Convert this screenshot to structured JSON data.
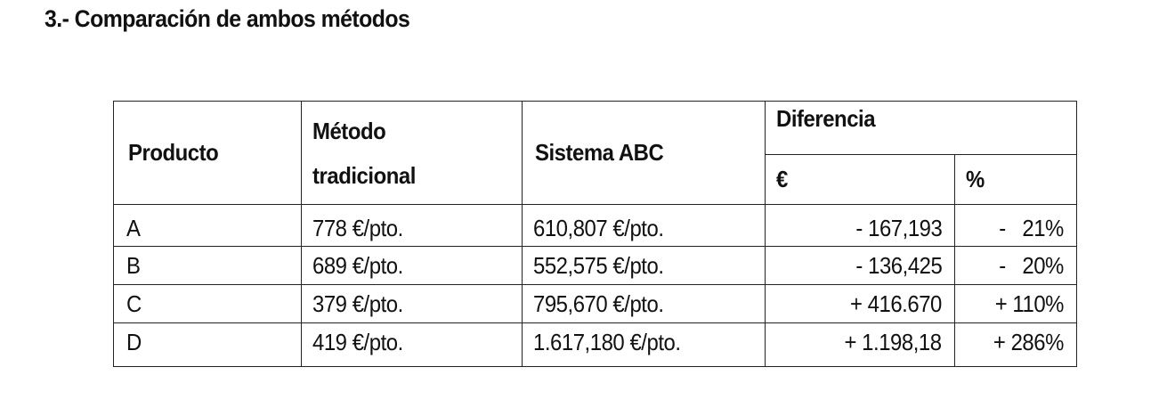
{
  "heading": "3.- Comparación de ambos métodos",
  "table": {
    "headers": {
      "producto": "Producto",
      "metodo_line1": "Método",
      "metodo_line2": "tradicional",
      "sistema_abc": "Sistema ABC",
      "diferencia": "Diferencia",
      "eur": "€",
      "pct": "%"
    },
    "rows": [
      {
        "producto": "A",
        "tradicional": "778 €/pto.",
        "abc": "610,807 €/pto.",
        "dif_eur": "- 167,193",
        "dif_pct": "-   21%"
      },
      {
        "producto": "B",
        "tradicional": "689 €/pto.",
        "abc": "552,575 €/pto.",
        "dif_eur": "- 136,425",
        "dif_pct": "-   20%"
      },
      {
        "producto": "C",
        "tradicional": "379 €/pto.",
        "abc": "795,670 €/pto.",
        "dif_eur": "+ 416.670",
        "dif_pct": "+ 110%"
      },
      {
        "producto": "D",
        "tradicional": "419 €/pto.",
        "abc": "1.617,180 €/pto.",
        "dif_eur": "+ 1.198,18",
        "dif_pct": "+ 286%"
      }
    ]
  }
}
